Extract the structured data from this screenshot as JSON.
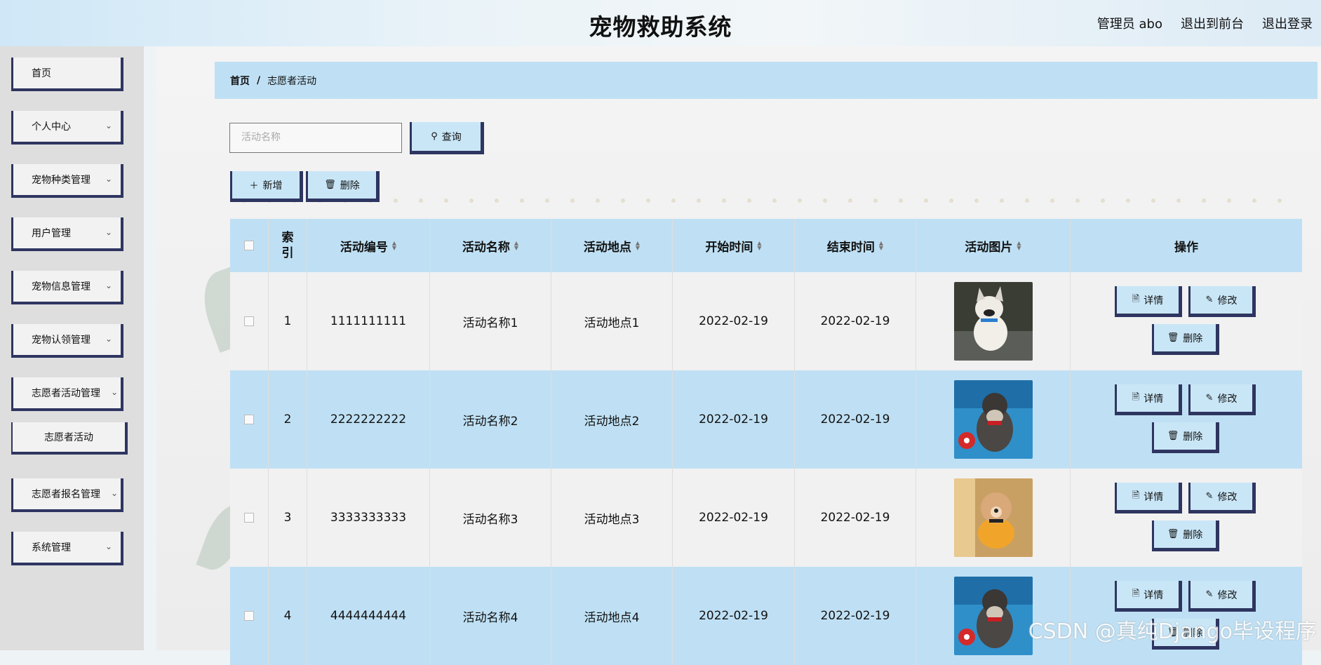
{
  "header": {
    "title": "宠物救助系统",
    "admin": "管理员 abo",
    "to_front": "退出到前台",
    "logout": "退出登录"
  },
  "sidebar": {
    "items": [
      {
        "label": "首页",
        "has_children": false
      },
      {
        "label": "个人中心",
        "has_children": true
      },
      {
        "label": "宠物种类管理",
        "has_children": true
      },
      {
        "label": "用户管理",
        "has_children": true
      },
      {
        "label": "宠物信息管理",
        "has_children": true
      },
      {
        "label": "宠物认领管理",
        "has_children": true
      },
      {
        "label": "志愿者活动管理",
        "has_children": true
      },
      {
        "label": "志愿者报名管理",
        "has_children": true
      },
      {
        "label": "系统管理",
        "has_children": true
      }
    ],
    "sub_item": "志愿者活动"
  },
  "breadcrumb": {
    "home": "首页",
    "sep": "/",
    "current": "志愿者活动"
  },
  "search": {
    "placeholder": "活动名称",
    "button": "查询"
  },
  "toolbar": {
    "add": "新增",
    "delete": "删除"
  },
  "table": {
    "headers": [
      "索引",
      "活动编号",
      "活动名称",
      "活动地点",
      "开始时间",
      "结束时间",
      "活动图片",
      "操作"
    ],
    "rows": [
      {
        "index": "1",
        "code": "1111111111",
        "name": "活动名称1",
        "place": "活动地点1",
        "start": "2022-02-19",
        "end": "2022-02-19",
        "image": "french-bulldog-photo"
      },
      {
        "index": "2",
        "code": "2222222222",
        "name": "活动名称2",
        "place": "活动地点2",
        "start": "2022-02-19",
        "end": "2022-02-19",
        "image": "schnauzer-photo"
      },
      {
        "index": "3",
        "code": "3333333333",
        "name": "活动名称3",
        "place": "活动地点3",
        "start": "2022-02-19",
        "end": "2022-02-19",
        "image": "poodle-photo"
      },
      {
        "index": "4",
        "code": "4444444444",
        "name": "活动名称4",
        "place": "活动地点4",
        "start": "2022-02-19",
        "end": "2022-02-19",
        "image": "schnauzer-photo"
      }
    ],
    "actions": {
      "detail": "详情",
      "edit": "修改",
      "delete": "删除"
    }
  },
  "watermark": "CSDN @真纯Django毕设程序",
  "colors": {
    "accent_blue": "#bfe0f4",
    "border_navy": "#2e3560"
  }
}
